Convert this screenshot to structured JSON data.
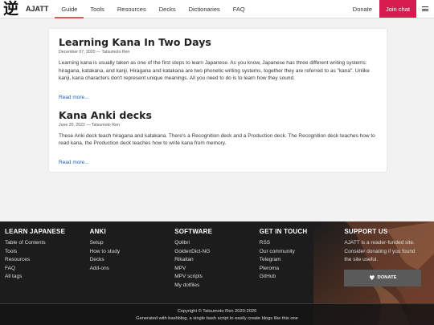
{
  "nav": {
    "logo_glyph": "逆",
    "logo_text": "AJATT",
    "links": [
      "Guide",
      "Tools",
      "Resources",
      "Decks",
      "Dictionaries",
      "FAQ"
    ],
    "donate": "Donate",
    "join_chat": "Join chat"
  },
  "posts": [
    {
      "title": "Learning Kana In Two Days",
      "meta": "December 07, 2020 — Tatsumoto Ren",
      "body": "Learning kana is usually taken as one of the first steps to learn Japanese. As you know, Japanese has three different writing systems: hiragana, katakana, and kanji. Hiragana and katakana are two phonetic writing systems, together they are referred to as \"kana\". Unlike kanji, kana characters don't represent unique meanings. All you need to do is to learn how they sound.",
      "more": "Read more..."
    },
    {
      "title": "Kana Anki decks",
      "meta": "June 20, 2022 — Tatsumoto Ren",
      "body": "These Anki deck teach hiragana and katakana. There's a Recognition deck and a Production deck. The Recognition deck teaches how to read kana, the Production deck teaches how to write kana from memory.",
      "more": "Read more..."
    }
  ],
  "footer": {
    "learn": {
      "heading": "LEARN JAPANESE",
      "links": [
        "Table of Contents",
        "Tools",
        "Resources",
        "FAQ",
        "All tags"
      ]
    },
    "anki": {
      "heading": "ANKI",
      "links": [
        "Setup",
        "How to study",
        "Decks",
        "Add-ons"
      ]
    },
    "software": {
      "heading": "SOFTWARE",
      "links": [
        "Qolibri",
        "GoldenDict-NG",
        "Rikaitan",
        "MPV",
        "MPV scripts",
        "My dotfiles"
      ]
    },
    "contact": {
      "heading": "GET IN TOUCH",
      "links": [
        "RSS",
        "Our community",
        "Telegram",
        "Pleroma",
        "GitHub"
      ]
    },
    "support": {
      "heading": "SUPPORT US",
      "text": "AJATT is a reader-funded site. Consider donating if you found the site useful.",
      "button": "DONATE"
    },
    "copyright": "Copyright © Tatsumoto Ren 2020-2026",
    "generated": "Generated with bashblog, a single bash script to easily create blogs like this one"
  },
  "colors": {
    "accent": "#d81b4f",
    "active_underline": "#e05a5a",
    "link": "#1a5fb4",
    "footer_bg": "#1c1c1c",
    "donate_button": "#5a5a5a"
  },
  "icons": [
    "menu-icon",
    "heart-icon"
  ]
}
